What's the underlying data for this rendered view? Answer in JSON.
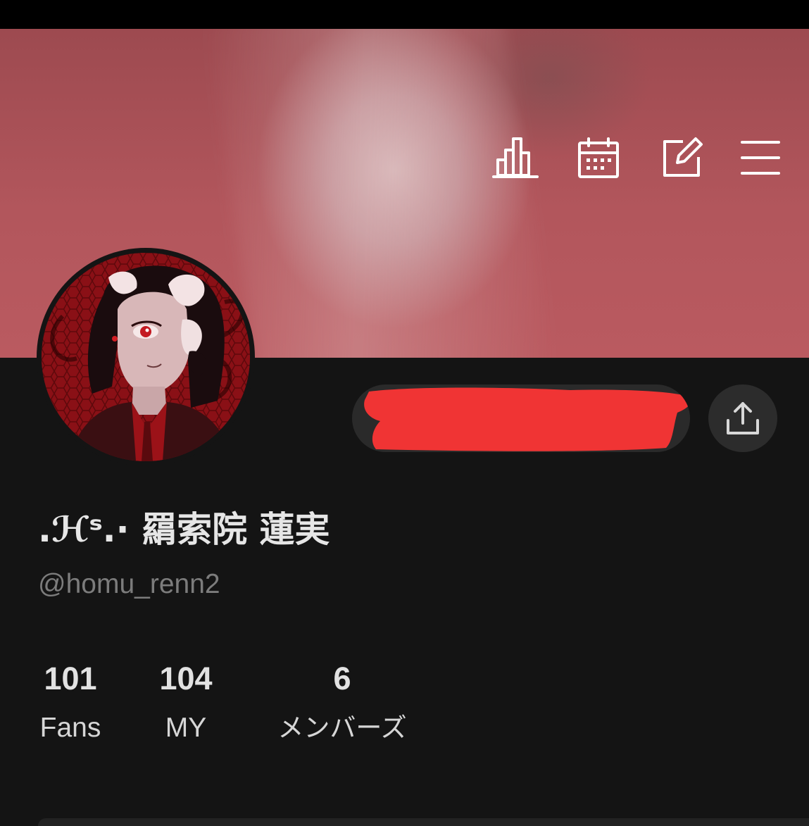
{
  "header": {
    "icons": [
      "stats-icon",
      "calendar-icon",
      "edit-icon",
      "menu-icon"
    ]
  },
  "profile": {
    "display_name": ".ℋˢ.· 羂索院 蓮実",
    "username": "@homu_renn2"
  },
  "actions": {
    "follow_button_label": "",
    "share_icon": "share-icon"
  },
  "stats": {
    "fans_count": "101",
    "fans_label": "Fans",
    "my_count": "104",
    "my_label": "MY",
    "members_count": "6",
    "members_label": "メンバーズ"
  },
  "colors": {
    "background": "#141414",
    "banner": "#b2565c",
    "redaction": "#f03434",
    "button_bg": "#2a2a2a"
  }
}
